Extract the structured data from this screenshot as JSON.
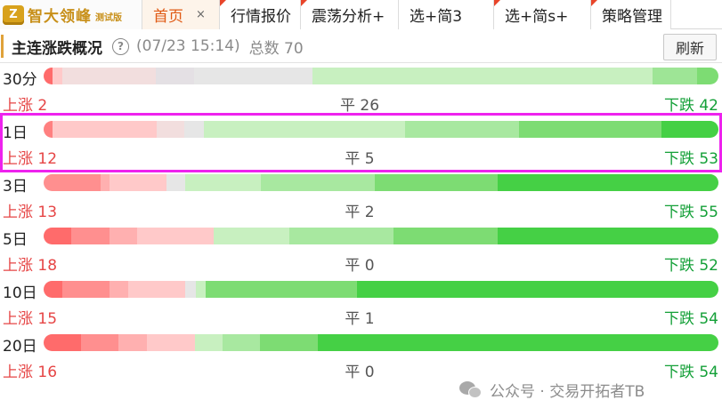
{
  "app": {
    "logo_mark": "Z",
    "name": "智大领峰",
    "edition": "测试版"
  },
  "tabs": [
    {
      "label": "首页",
      "active": true,
      "closable": true,
      "close_glyph": "×",
      "flag": false
    },
    {
      "label": "行情报价",
      "active": false,
      "closable": false,
      "flag": true
    },
    {
      "label": "震荡分析+",
      "active": false,
      "closable": false,
      "flag": true
    },
    {
      "label": "选+简3",
      "active": false,
      "closable": false,
      "flag": false
    },
    {
      "label": "选+简s+",
      "active": false,
      "closable": false,
      "flag": true
    },
    {
      "label": "策略管理",
      "active": false,
      "closable": false,
      "flag": true
    }
  ],
  "header": {
    "title": "主连涨跌概况",
    "help_glyph": "?",
    "timestamp": "(07/23 15:14)",
    "total": "总数 70",
    "refresh_label": "刷新"
  },
  "colors": {
    "up_text": "#e64545",
    "down_text": "#14a038",
    "flat_text": "#555555",
    "highlight": "#ee22ee"
  },
  "rows": [
    {
      "period": "30分",
      "up": "上涨 2",
      "flat": "平 26",
      "down": "下跌 42",
      "segments": [
        {
          "w": 1.3,
          "c": "#ff6b6b"
        },
        {
          "w": 1.5,
          "c": "#ffc9c9"
        },
        {
          "w": 13.8,
          "c": "#f2dede"
        },
        {
          "w": 5.7,
          "c": "#e4e0e4"
        },
        {
          "w": 17.5,
          "c": "#e6e6e6"
        },
        {
          "w": 50.4,
          "c": "#c8f0c0"
        },
        {
          "w": 6.7,
          "c": "#9ee596"
        },
        {
          "w": 3.1,
          "c": "#7ddc73"
        }
      ]
    },
    {
      "period": "1日",
      "up": "上涨 12",
      "flat": "平 5",
      "down": "下跌 53",
      "highlighted": true,
      "segments": [
        {
          "w": 1.3,
          "c": "#ff8080"
        },
        {
          "w": 15.5,
          "c": "#ffc9c9"
        },
        {
          "w": 4.0,
          "c": "#f2dede"
        },
        {
          "w": 2.9,
          "c": "#e6e6e6"
        },
        {
          "w": 29.9,
          "c": "#c8f0c0"
        },
        {
          "w": 16.8,
          "c": "#a8e8a0"
        },
        {
          "w": 21.1,
          "c": "#7ddc73"
        },
        {
          "w": 8.5,
          "c": "#45d045"
        }
      ]
    },
    {
      "period": "3日",
      "up": "上涨 13",
      "flat": "平 2",
      "down": "下跌 55",
      "segments": [
        {
          "w": 8.5,
          "c": "#ff8f8f"
        },
        {
          "w": 1.3,
          "c": "#ffb0b0"
        },
        {
          "w": 8.4,
          "c": "#ffc9c9"
        },
        {
          "w": 2.8,
          "c": "#e6e6e6"
        },
        {
          "w": 11.2,
          "c": "#c8f0c0"
        },
        {
          "w": 16.9,
          "c": "#a8e8a0"
        },
        {
          "w": 18.2,
          "c": "#7ddc73"
        },
        {
          "w": 32.7,
          "c": "#45d045"
        }
      ]
    },
    {
      "period": "5日",
      "up": "上涨 18",
      "flat": "平 0",
      "down": "下跌 52",
      "segments": [
        {
          "w": 4.1,
          "c": "#ff6b6b"
        },
        {
          "w": 5.6,
          "c": "#ff8f8f"
        },
        {
          "w": 4.2,
          "c": "#ffb0b0"
        },
        {
          "w": 11.3,
          "c": "#ffc9c9"
        },
        {
          "w": 11.2,
          "c": "#c8f0c0"
        },
        {
          "w": 15.5,
          "c": "#a8e8a0"
        },
        {
          "w": 15.4,
          "c": "#7ddc73"
        },
        {
          "w": 32.7,
          "c": "#45d045"
        }
      ]
    },
    {
      "period": "10日",
      "up": "上涨 15",
      "flat": "平 1",
      "down": "下跌 54",
      "segments": [
        {
          "w": 2.8,
          "c": "#ff6b6b"
        },
        {
          "w": 7.0,
          "c": "#ff8f8f"
        },
        {
          "w": 2.8,
          "c": "#ffb0b0"
        },
        {
          "w": 8.4,
          "c": "#ffc9c9"
        },
        {
          "w": 1.6,
          "c": "#e6e6e6"
        },
        {
          "w": 1.4,
          "c": "#c8f0c0"
        },
        {
          "w": 22.4,
          "c": "#7ddc73"
        },
        {
          "w": 53.6,
          "c": "#45d045"
        }
      ]
    },
    {
      "period": "20日",
      "up": "上涨 16",
      "flat": "平 0",
      "down": "下跌 54",
      "segments": [
        {
          "w": 5.5,
          "c": "#ff6b6b"
        },
        {
          "w": 5.6,
          "c": "#ff8f8f"
        },
        {
          "w": 4.2,
          "c": "#ffb0b0"
        },
        {
          "w": 7.1,
          "c": "#ffc9c9"
        },
        {
          "w": 4.1,
          "c": "#c8f0c0"
        },
        {
          "w": 5.6,
          "c": "#a8e8a0"
        },
        {
          "w": 8.5,
          "c": "#7ddc73"
        },
        {
          "w": 59.4,
          "c": "#45d045"
        }
      ]
    }
  ],
  "watermark": {
    "text": "公众号 · 交易开拓者TB",
    "icon": "wechat-icon"
  }
}
